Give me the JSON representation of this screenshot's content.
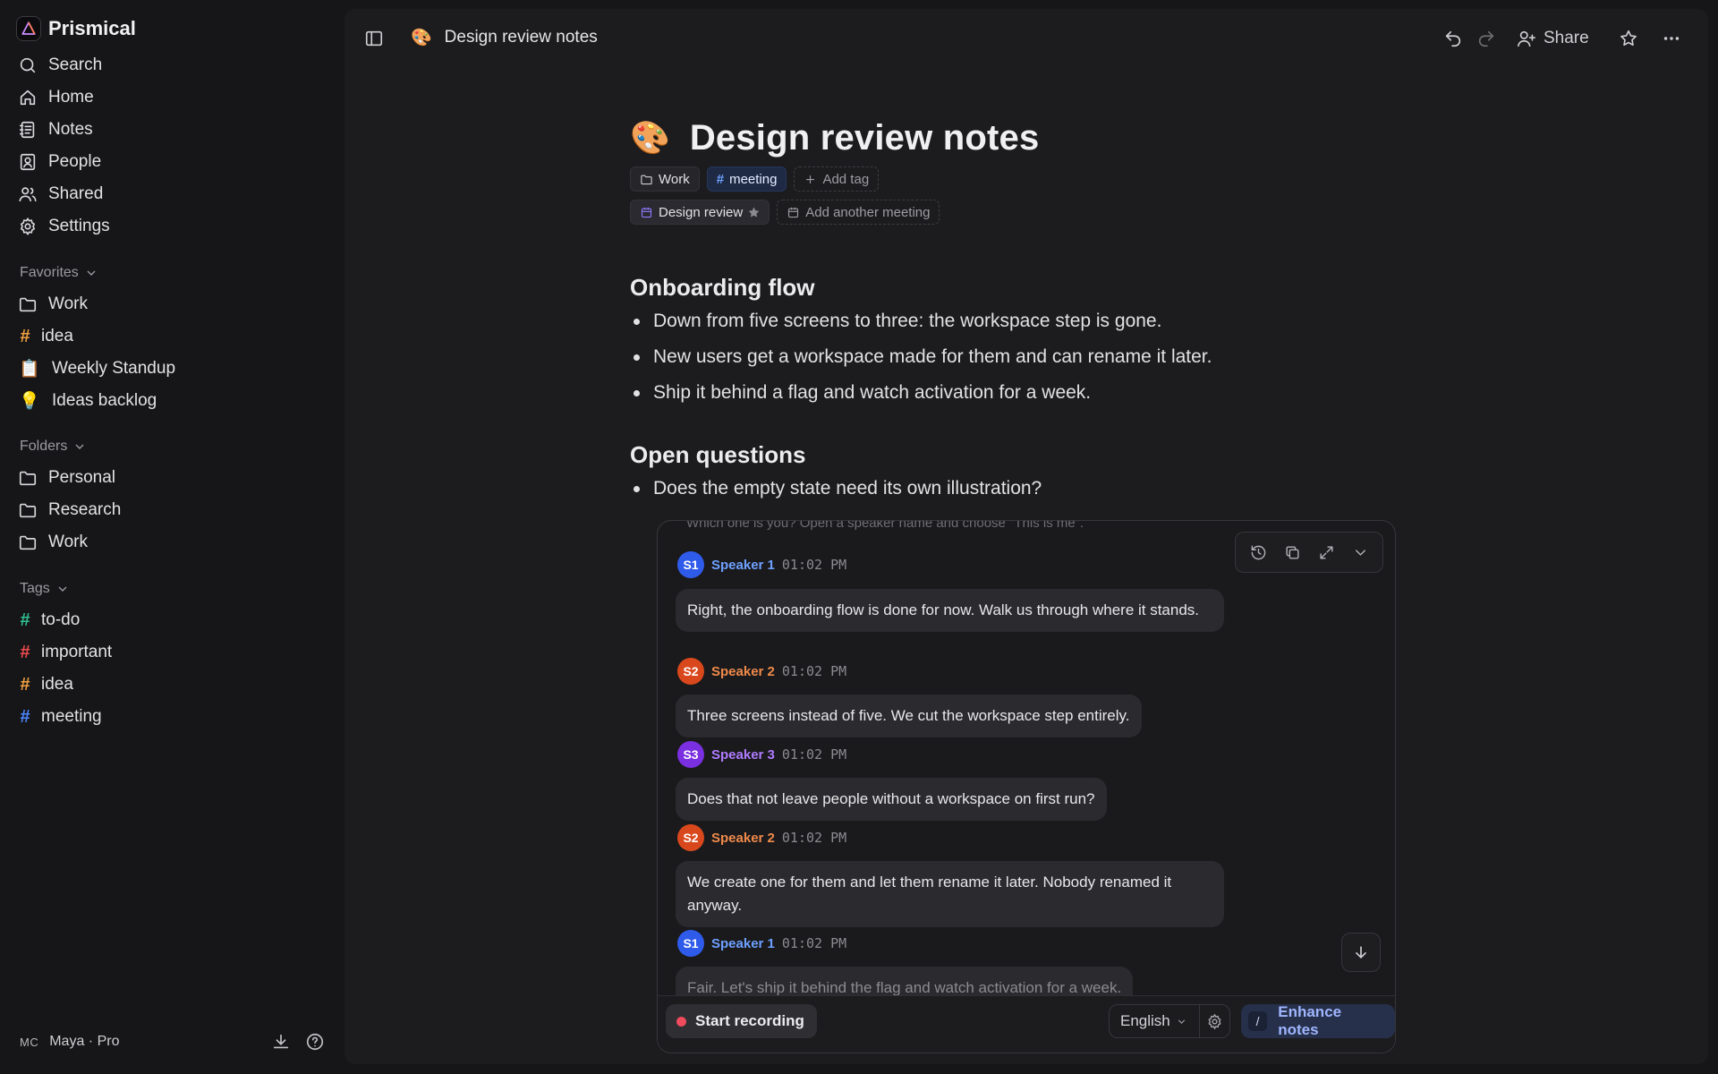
{
  "app": {
    "name": "Prismical"
  },
  "sidebar": {
    "nav": [
      {
        "label": "Search",
        "icon": "search-icon"
      },
      {
        "label": "Home",
        "icon": "home-icon"
      },
      {
        "label": "Notes",
        "icon": "notes-icon"
      },
      {
        "label": "People",
        "icon": "people-icon"
      },
      {
        "label": "Shared",
        "icon": "shared-icon"
      },
      {
        "label": "Settings",
        "icon": "gear-icon"
      }
    ],
    "favorites": {
      "title": "Favorites",
      "items": [
        {
          "label": "Work",
          "kind": "folder"
        },
        {
          "label": "idea",
          "kind": "tag",
          "color": "#f0a040"
        },
        {
          "label": "Weekly Standup",
          "kind": "emoji",
          "emoji": "📋"
        },
        {
          "label": "Ideas backlog",
          "kind": "emoji",
          "emoji": "💡"
        }
      ]
    },
    "folders": {
      "title": "Folders",
      "items": [
        {
          "label": "Personal"
        },
        {
          "label": "Research"
        },
        {
          "label": "Work"
        }
      ]
    },
    "tags": {
      "title": "Tags",
      "items": [
        {
          "label": "to-do",
          "color": "#2fbf8f"
        },
        {
          "label": "important",
          "color": "#ef4b4b"
        },
        {
          "label": "idea",
          "color": "#f0a040"
        },
        {
          "label": "meeting",
          "color": "#4a86ff"
        }
      ]
    },
    "user": {
      "initials": "MC",
      "name": "Maya · Pro"
    }
  },
  "topbar": {
    "doc_emoji": "🎨",
    "doc_title": "Design review notes",
    "share_label": "Share"
  },
  "document": {
    "emoji": "🎨",
    "title": "Design review notes",
    "folder_chip": "Work",
    "tag_chip": "meeting",
    "add_tag": "Add tag",
    "meeting_chip": "Design review",
    "add_meeting": "Add another meeting",
    "sections": [
      {
        "heading": "Onboarding flow",
        "bullets": [
          "Down from five screens to three: the workspace step is gone.",
          "New users get a workspace made for them and can rename it later.",
          "Ship it behind a flag and watch activation for a week."
        ]
      },
      {
        "heading": "Open questions",
        "bullets": [
          "Does the empty state need its own illustration?"
        ]
      }
    ]
  },
  "transcript": {
    "hint": "Which one is you? Open a speaker name and choose \"This is me\".",
    "messages": [
      {
        "initials": "S1",
        "speaker": "Speaker 1",
        "time": "01:02 PM",
        "color": "#2f5bea",
        "name_color": "#6ea0ff",
        "text": "Right, the onboarding flow is done for now. Walk us through where it stands."
      },
      {
        "initials": "S2",
        "speaker": "Speaker 2",
        "time": "01:02 PM",
        "color": "#d9481c",
        "name_color": "#f08a4b",
        "text": "Three screens instead of five. We cut the workspace step entirely."
      },
      {
        "initials": "S3",
        "speaker": "Speaker 3",
        "time": "01:02 PM",
        "color": "#7a2fe0",
        "name_color": "#b07cff",
        "text": "Does that not leave people without a workspace on first run?"
      },
      {
        "initials": "S2",
        "speaker": "Speaker 2",
        "time": "01:02 PM",
        "color": "#d9481c",
        "name_color": "#f08a4b",
        "text": "We create one for them and let them rename it later. Nobody renamed it anyway."
      },
      {
        "initials": "S1",
        "speaker": "Speaker 1",
        "time": "01:02 PM",
        "color": "#2f5bea",
        "name_color": "#6ea0ff",
        "text": "Fair. Let's ship it behind the flag and watch activation for a week."
      }
    ],
    "footer": {
      "record_label": "Start recording",
      "language": "English",
      "enhance_label": "Enhance notes",
      "enhance_shortcut": "/"
    }
  }
}
